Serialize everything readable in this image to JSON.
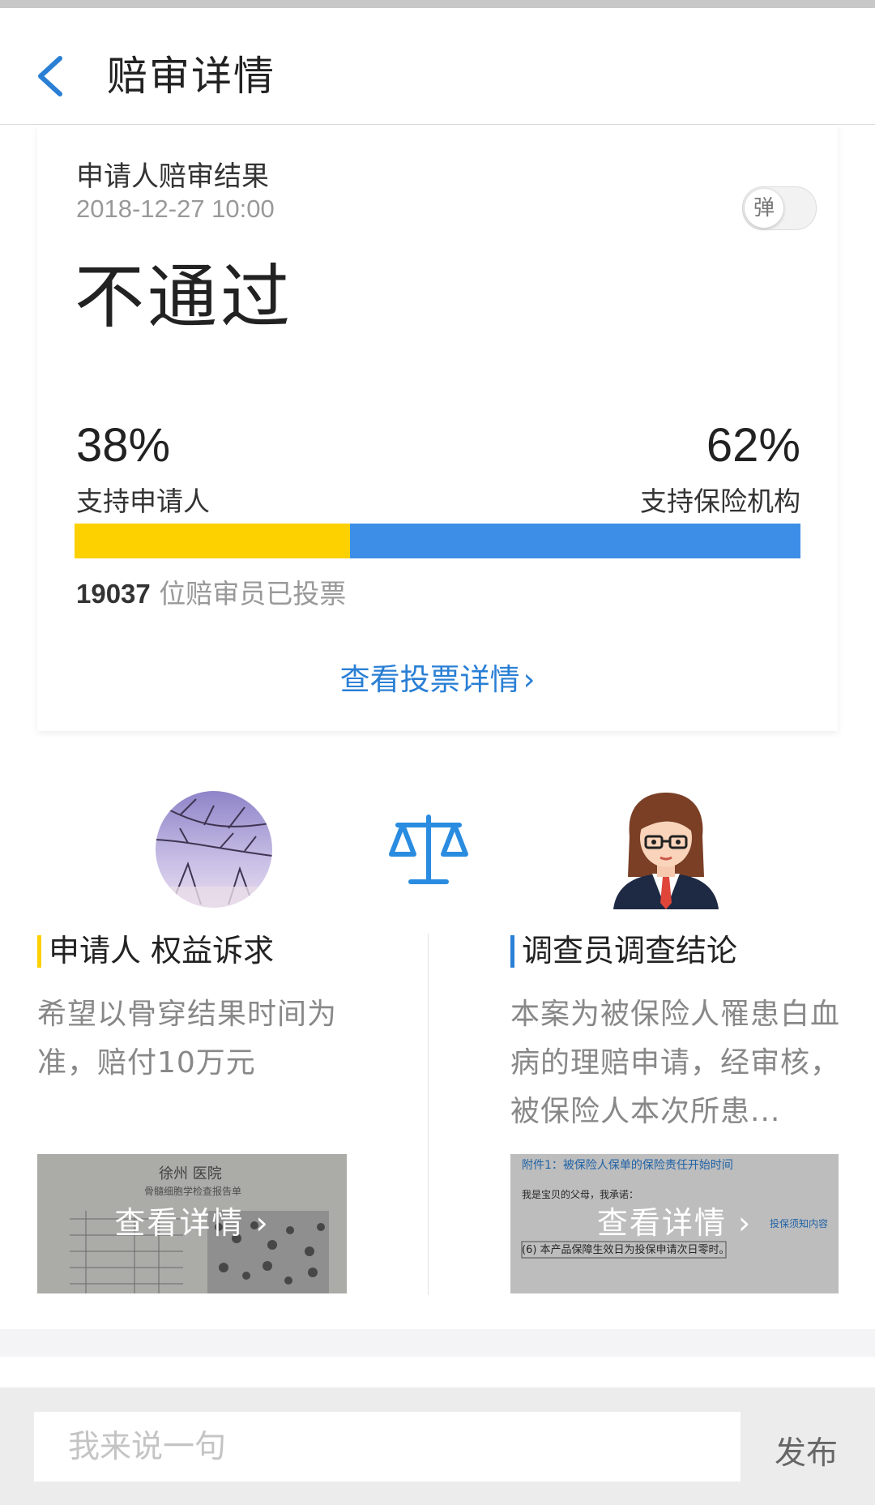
{
  "header": {
    "title": "赔审详情",
    "back_icon": "chevron-left-icon",
    "accent": "#2a7fd5"
  },
  "result": {
    "label": "申请人赔审结果",
    "time": "2018-12-27 10:00",
    "verdict": "不通过",
    "toggle_label": "弹",
    "support_applicant_pct": "38%",
    "support_applicant_label": "支持申请人",
    "support_insurer_pct": "62%",
    "support_insurer_label": "支持保险机构",
    "applicant_fraction": 0.38,
    "applicant_color": "#fdd000",
    "insurer_color": "#3d8ee6",
    "voter_count": "19037",
    "voter_suffix": " 位赔审员已投票",
    "detail_link": "查看投票详情",
    "detail_link_chevron": "›"
  },
  "applicant": {
    "title": "申请人 权益诉求",
    "text": "希望以骨穿结果时间为准，赔付10万元",
    "view_label": "查看详情 ›",
    "thumb_doc_title": "徐州   医院",
    "thumb_doc_subtitle": "骨髓细胞学检查报告单"
  },
  "investigator": {
    "title": "调查员调查结论",
    "text": "本案为被保险人罹患白血病的理赔申请，经审核，被保险人本次所患...",
    "view_label": "查看详情 ›",
    "thumb_heading": "附件1：被保险人保单的保险责任开始时间",
    "thumb_line1": "我是宝贝的父母，我承诺：",
    "thumb_line2": "(6) 本产品保障生效日为投保申请次日零时。",
    "thumb_side": "投保须知内容"
  },
  "comment": {
    "placeholder": "我来说一句",
    "publish_label": "发布"
  }
}
